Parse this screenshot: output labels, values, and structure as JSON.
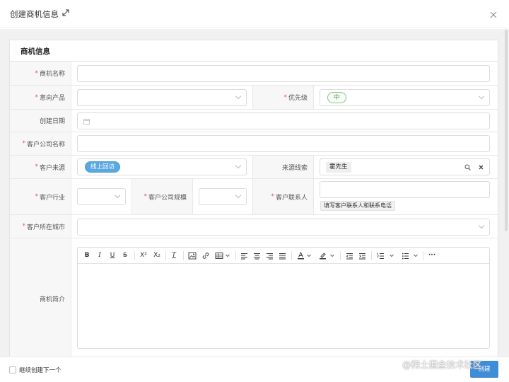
{
  "dialog": {
    "title": "创建商机信息"
  },
  "section": {
    "title": "商机信息"
  },
  "fields": {
    "name": {
      "label": "商机名称",
      "required": "*"
    },
    "product": {
      "label": "意向产品",
      "required": "*"
    },
    "priority": {
      "label": "优先级",
      "required": "*",
      "value": "中"
    },
    "created_date": {
      "label": "创建日期"
    },
    "company_name": {
      "label": "客户公司名称",
      "required": "*"
    },
    "source": {
      "label": "客户来源",
      "required": "*",
      "value": "线上回访"
    },
    "lead": {
      "label": "来源线索",
      "value": "霍先生"
    },
    "industry": {
      "label": "客户行业",
      "required": "*"
    },
    "company_size": {
      "label": "客户公司规模",
      "required": "*"
    },
    "contact": {
      "label": "客户联系人",
      "required": "*",
      "hint": "填写客户联系人和联系电话"
    },
    "city": {
      "label": "客户所在城市",
      "required": "*"
    },
    "intro": {
      "label": "商机简介"
    }
  },
  "toolbar": {
    "bold": "B",
    "italic": "I",
    "underline": "U",
    "strike": "S",
    "superscript": "X²",
    "subscript": "X₂",
    "clear_format": "T",
    "more": "···"
  },
  "footer": {
    "continue_label": "继续创建下一个",
    "create_label": "创建"
  },
  "watermark": "@稀土掘金技术社区",
  "colors": {
    "accent": "#3f8dd8",
    "required": "#e55555",
    "tag_blue": "#5aa8e0",
    "tag_green": "#8cc08c"
  }
}
